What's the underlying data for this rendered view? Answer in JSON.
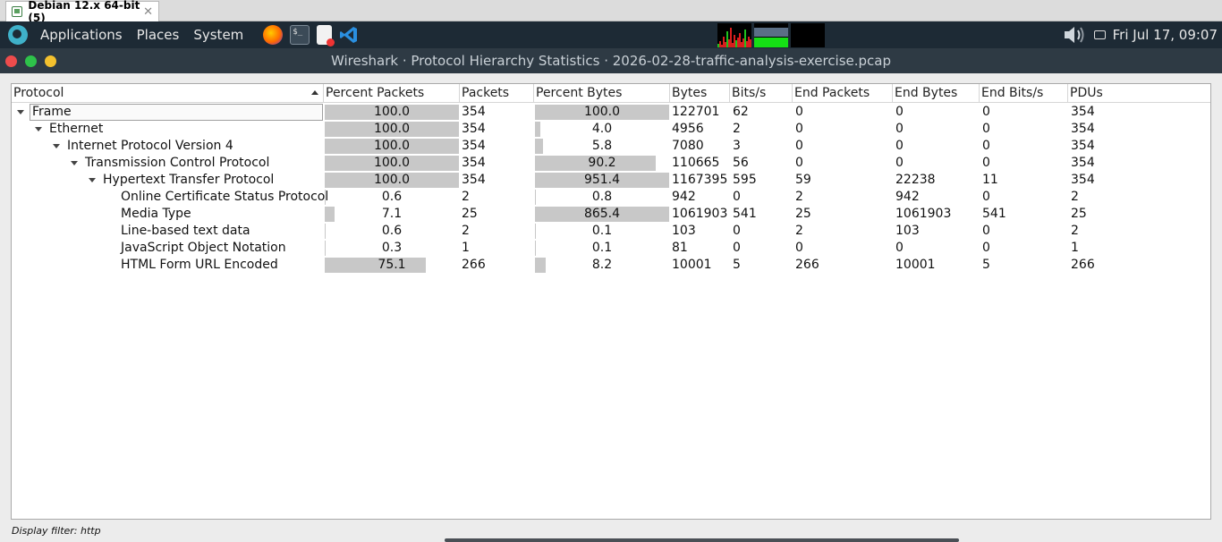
{
  "vm_tab": {
    "title": "Debian 12.x 64-bit (5)",
    "close_glyph": "✕"
  },
  "panel": {
    "menus": [
      "Applications",
      "Places",
      "System"
    ],
    "clock": "Fri Jul 17, 09:07"
  },
  "window": {
    "title": "Wireshark · Protocol Hierarchy Statistics · 2026-02-28-traffic-analysis-exercise.pcap"
  },
  "table": {
    "columns": [
      "Protocol",
      "Percent Packets",
      "Packets",
      "Percent Bytes",
      "Bytes",
      "Bits/s",
      "End Packets",
      "End Bytes",
      "End Bits/s",
      "PDUs"
    ],
    "rows": [
      {
        "protocol": "Frame",
        "depth": 0,
        "expanded": true,
        "selected": true,
        "pct_packets": "100.0",
        "packets": "354",
        "pct_bytes": "100.0",
        "bytes": "122701",
        "bits_s": "62",
        "end_packets": "0",
        "end_bytes": "0",
        "end_bits_s": "0",
        "pdus": "354",
        "pkt_fill": 1.0,
        "byte_fill": 1.0
      },
      {
        "protocol": "Ethernet",
        "depth": 1,
        "expanded": true,
        "pct_packets": "100.0",
        "packets": "354",
        "pct_bytes": "4.0",
        "bytes": "4956",
        "bits_s": "2",
        "end_packets": "0",
        "end_bytes": "0",
        "end_bits_s": "0",
        "pdus": "354",
        "pkt_fill": 1.0,
        "byte_fill": 0.04
      },
      {
        "protocol": "Internet Protocol Version 4",
        "depth": 2,
        "expanded": true,
        "pct_packets": "100.0",
        "packets": "354",
        "pct_bytes": "5.8",
        "bytes": "7080",
        "bits_s": "3",
        "end_packets": "0",
        "end_bytes": "0",
        "end_bits_s": "0",
        "pdus": "354",
        "pkt_fill": 1.0,
        "byte_fill": 0.058
      },
      {
        "protocol": "Transmission Control Protocol",
        "depth": 3,
        "expanded": true,
        "pct_packets": "100.0",
        "packets": "354",
        "pct_bytes": "90.2",
        "bytes": "110665",
        "bits_s": "56",
        "end_packets": "0",
        "end_bytes": "0",
        "end_bits_s": "0",
        "pdus": "354",
        "pkt_fill": 1.0,
        "byte_fill": 0.902
      },
      {
        "protocol": "Hypertext Transfer Protocol",
        "depth": 4,
        "expanded": true,
        "pct_packets": "100.0",
        "packets": "354",
        "pct_bytes": "951.4",
        "bytes": "1167395",
        "bits_s": "595",
        "end_packets": "59",
        "end_bytes": "22238",
        "end_bits_s": "11",
        "pdus": "354",
        "pkt_fill": 1.0,
        "byte_fill": 1.0
      },
      {
        "protocol": "Online Certificate Status Protocol",
        "depth": 5,
        "pct_packets": "0.6",
        "packets": "2",
        "pct_bytes": "0.8",
        "bytes": "942",
        "bits_s": "0",
        "end_packets": "2",
        "end_bytes": "942",
        "end_bits_s": "0",
        "pdus": "2",
        "pkt_fill": 0.0,
        "byte_fill": 0.0
      },
      {
        "protocol": "Media Type",
        "depth": 5,
        "pct_packets": "7.1",
        "packets": "25",
        "pct_bytes": "865.4",
        "bytes": "1061903",
        "bits_s": "541",
        "end_packets": "25",
        "end_bytes": "1061903",
        "end_bits_s": "541",
        "pdus": "25",
        "pkt_fill": 0.071,
        "byte_fill": 1.0
      },
      {
        "protocol": "Line-based text data",
        "depth": 5,
        "pct_packets": "0.6",
        "packets": "2",
        "pct_bytes": "0.1",
        "bytes": "103",
        "bits_s": "0",
        "end_packets": "2",
        "end_bytes": "103",
        "end_bits_s": "0",
        "pdus": "2",
        "pkt_fill": 0.0,
        "byte_fill": 0.0
      },
      {
        "protocol": "JavaScript Object Notation",
        "depth": 5,
        "pct_packets": "0.3",
        "packets": "1",
        "pct_bytes": "0.1",
        "bytes": "81",
        "bits_s": "0",
        "end_packets": "0",
        "end_bytes": "0",
        "end_bits_s": "0",
        "pdus": "1",
        "pkt_fill": 0.0,
        "byte_fill": 0.0
      },
      {
        "protocol": "HTML Form URL Encoded",
        "depth": 5,
        "pct_packets": "75.1",
        "packets": "266",
        "pct_bytes": "8.2",
        "bytes": "10001",
        "bits_s": "5",
        "end_packets": "266",
        "end_bytes": "10001",
        "end_bits_s": "5",
        "pdus": "266",
        "pkt_fill": 0.751,
        "byte_fill": 0.082
      }
    ]
  },
  "status": {
    "display_filter": "Display filter: http"
  }
}
